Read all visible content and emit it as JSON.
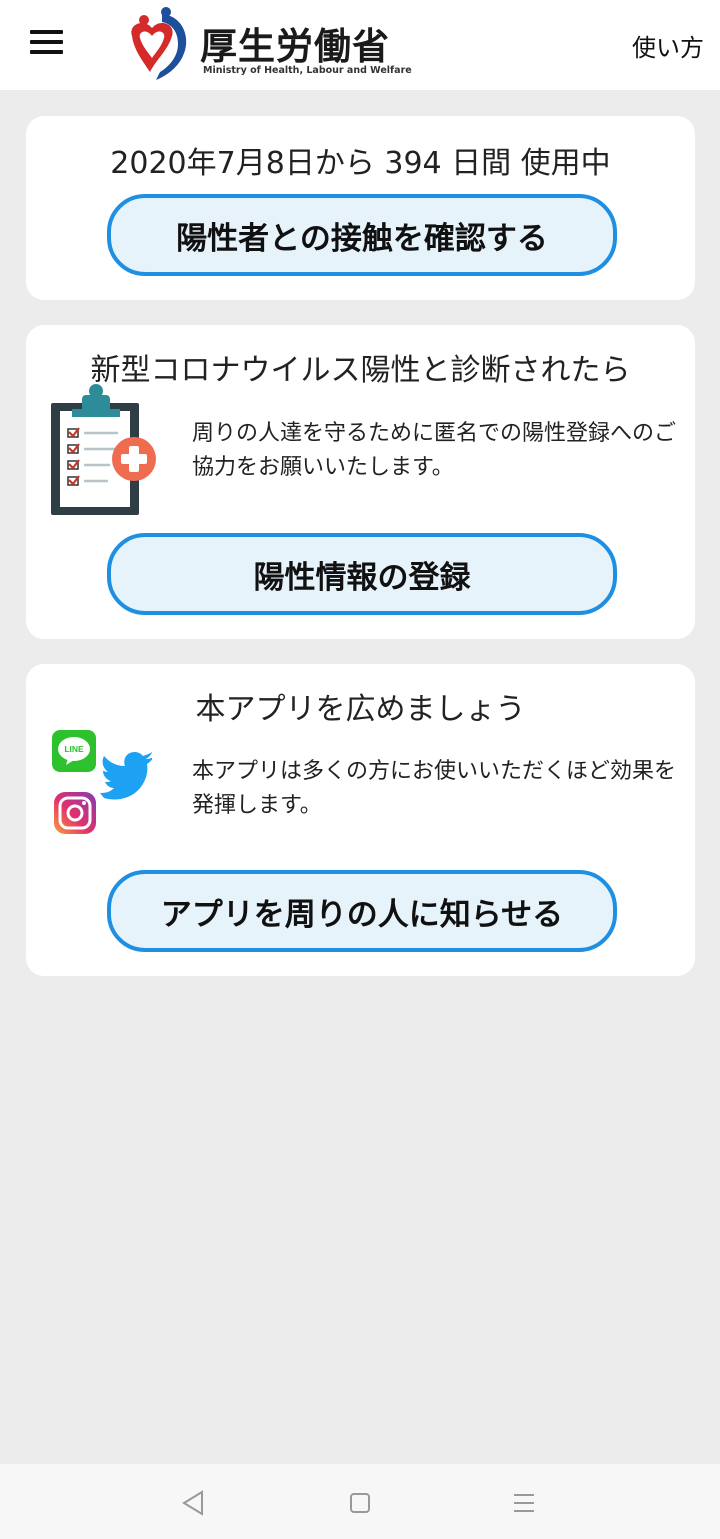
{
  "header": {
    "logo_title": "厚生労働省",
    "logo_subtitle": "Ministry of Health, Labour and Welfare",
    "help_label": "使い方"
  },
  "usage_card": {
    "usage_text": "2020年7月8日から 394 日間 使用中",
    "check_button_label": "陽性者との接触を確認する"
  },
  "positive_card": {
    "title": "新型コロナウイルス陽性と診断されたら",
    "description": "周りの人達を守るために匿名での陽性登録へのご協力をお願いいたします。",
    "register_button_label": "陽性情報の登録"
  },
  "share_card": {
    "title": "本アプリを広めましょう",
    "description": "本アプリは多くの方にお使いいただくほど効果を発揮します。",
    "line_icon_text": "LINE",
    "share_button_label": "アプリを周りの人に知らせる"
  },
  "colors": {
    "accent": "#1f8fe2",
    "button_fill": "#e6f3fb",
    "background": "#ececec"
  }
}
